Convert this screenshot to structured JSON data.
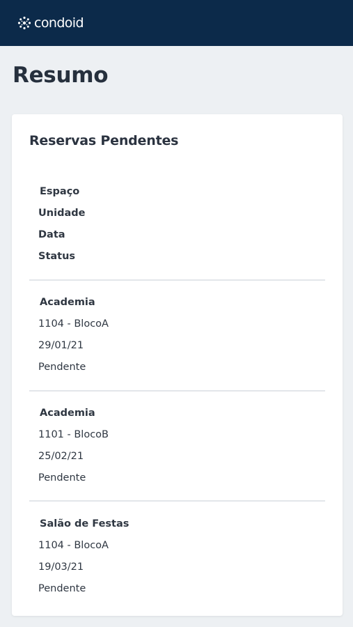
{
  "header": {
    "logo_text": "condoid",
    "logo_icon": "condoid-logo-icon",
    "background": "#0c2a4a"
  },
  "page": {
    "title": "Resumo"
  },
  "card": {
    "title": "Reservas Pendentes",
    "columns": [
      "Espaço",
      "Unidade",
      "Data",
      "Status"
    ],
    "rows": [
      {
        "space": "Academia",
        "unit": "1104 - BlocoA",
        "date": "29/01/21",
        "status": "Pendente"
      },
      {
        "space": "Academia",
        "unit": "1101 - BlocoB",
        "date": "25/02/21",
        "status": "Pendente"
      },
      {
        "space": "Salão de Festas",
        "unit": "1104 - BlocoA",
        "date": "19/03/21",
        "status": "Pendente"
      }
    ]
  }
}
